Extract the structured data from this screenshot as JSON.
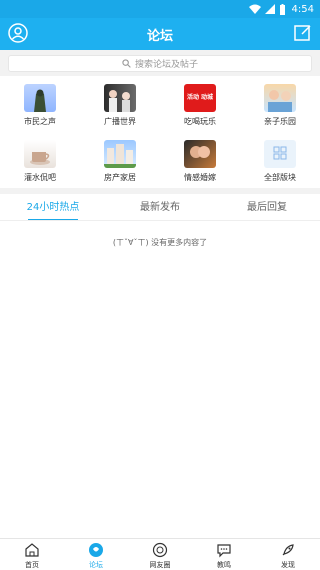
{
  "status": {
    "time": "4:54"
  },
  "header": {
    "title": "论坛"
  },
  "search": {
    "placeholder": "搜索论坛及帖子"
  },
  "grid": [
    {
      "label": "市民之声",
      "icon": "city-voice-thumb"
    },
    {
      "label": "广播世界",
      "icon": "radio-world-thumb"
    },
    {
      "label": "吃喝玩乐",
      "icon": "food-fun-thumb",
      "text": "活动 动城"
    },
    {
      "label": "亲子乐园",
      "icon": "family-park-thumb"
    },
    {
      "label": "灌水侃吧",
      "icon": "chat-bar-thumb"
    },
    {
      "label": "房产家居",
      "icon": "real-estate-thumb"
    },
    {
      "label": "情感婚嫁",
      "icon": "love-marriage-thumb"
    },
    {
      "label": "全部版块",
      "icon": "all-sections-icon"
    }
  ],
  "tabs": [
    {
      "label": "24小时热点"
    },
    {
      "label": "最新发布"
    },
    {
      "label": "最后回复"
    }
  ],
  "content": {
    "empty_text": "(ㄒˇ∀ˇㄒ) 没有更多内容了"
  },
  "bottom_nav": [
    {
      "label": "首页"
    },
    {
      "label": "论坛"
    },
    {
      "label": "网友圈"
    },
    {
      "label": "教鸣"
    },
    {
      "label": "发现"
    }
  ],
  "colors": {
    "accent": "#1aa8e8",
    "header": "#1eb0f0"
  }
}
